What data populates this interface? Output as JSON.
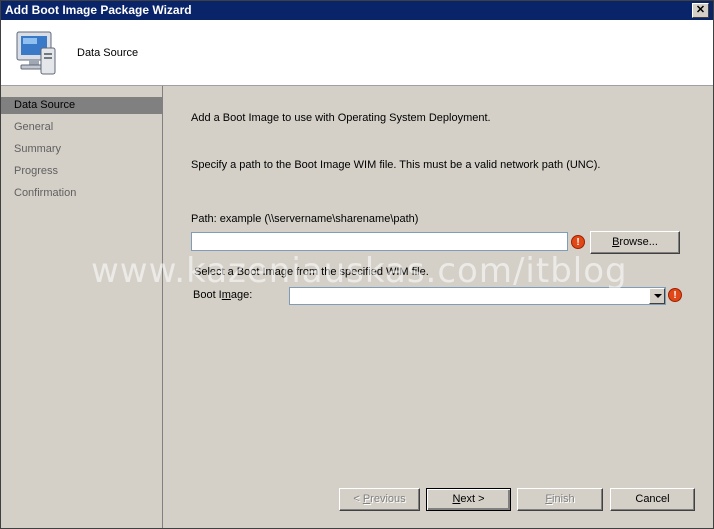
{
  "window": {
    "title": "Add Boot Image Package Wizard",
    "close_label": "✕"
  },
  "header": {
    "title": "Data Source"
  },
  "nav": {
    "items": [
      {
        "label": "Data Source",
        "active": true
      },
      {
        "label": "General",
        "active": false
      },
      {
        "label": "Summary",
        "active": false
      },
      {
        "label": "Progress",
        "active": false
      },
      {
        "label": "Confirmation",
        "active": false
      }
    ]
  },
  "content": {
    "intro": "Add a Boot Image to use with Operating System Deployment.",
    "specify": "Specify a path to the Boot Image WIM file. This must be a valid network path (UNC).",
    "path_label": "Path: example (\\\\servername\\sharename\\path)",
    "path_value": "",
    "browse_prefix": "",
    "browse_key": "B",
    "browse_rest": "rowse...",
    "select_text": "Select a Boot Image from the specified WIM file.",
    "boot_label_pre": "Boot I",
    "boot_label_key": "m",
    "boot_label_post": "age:",
    "boot_value": "",
    "error_glyph": "!"
  },
  "watermark": "www.kazeniauskas.com/itblog",
  "buttons": {
    "previous_pre": "< ",
    "previous_key": "P",
    "previous_rest": "revious",
    "next_key": "N",
    "next_rest": "ext >",
    "finish_key": "F",
    "finish_rest": "inish",
    "cancel": "Cancel"
  },
  "colors": {
    "titlebar": "#0a246a",
    "face": "#d4d0c8",
    "error": "#e04818"
  }
}
